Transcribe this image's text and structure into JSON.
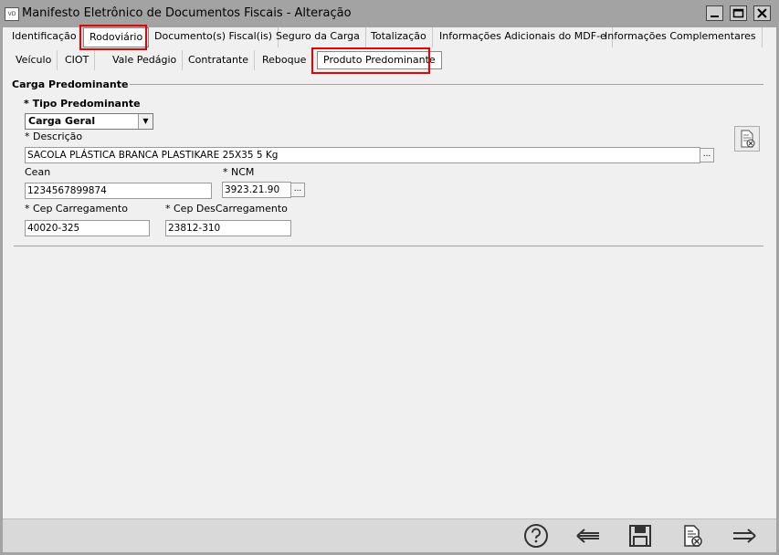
{
  "window": {
    "title": "Manifesto Eletrônico de Documentos Fiscais - Alteração",
    "app_icon_text": "VD"
  },
  "tabs_row1": [
    {
      "label": "Identificação"
    },
    {
      "label": "Rodoviário"
    },
    {
      "label": "Documento(s) Fiscal(is)"
    },
    {
      "label": "Seguro da Carga"
    },
    {
      "label": "Totalização"
    },
    {
      "label": "Informações Adicionais do MDF-e"
    },
    {
      "label": "Informações Complementares"
    }
  ],
  "tabs_row2": [
    {
      "label": "Veículo"
    },
    {
      "label": "CIOT"
    },
    {
      "label": "Vale Pedágio"
    },
    {
      "label": "Contratante"
    },
    {
      "label": "Reboque"
    },
    {
      "label": "Produto Predominante"
    }
  ],
  "form": {
    "group_title": "Carga Predominante",
    "tipo_label": "* Tipo Predominante",
    "tipo_value": "Carga Geral",
    "descricao_label": "* Descrição",
    "descricao_value": "SACOLA PLÁSTICA BRANCA PLASTIKARE 25X35  5 Kg",
    "cean_label": "Cean",
    "cean_value": "1234567899874",
    "ncm_label": "* NCM",
    "ncm_value": "3923.21.90",
    "cep_carregamento_label": "* Cep Carregamento",
    "cep_carregamento_value": "40020-325",
    "cep_descarregamento_label": "* Cep DesCarregamento",
    "cep_descarregamento_value": "23812-310",
    "ellipsis": "..."
  },
  "toolbar": {
    "icons": [
      "help-icon",
      "back-arrow-icon",
      "save-icon",
      "cancel-document-icon",
      "forward-arrow-icon"
    ]
  },
  "colors": {
    "highlight": "#e00000",
    "window_frame": "#a3a3a3",
    "client_bg": "#f0f0f0"
  }
}
